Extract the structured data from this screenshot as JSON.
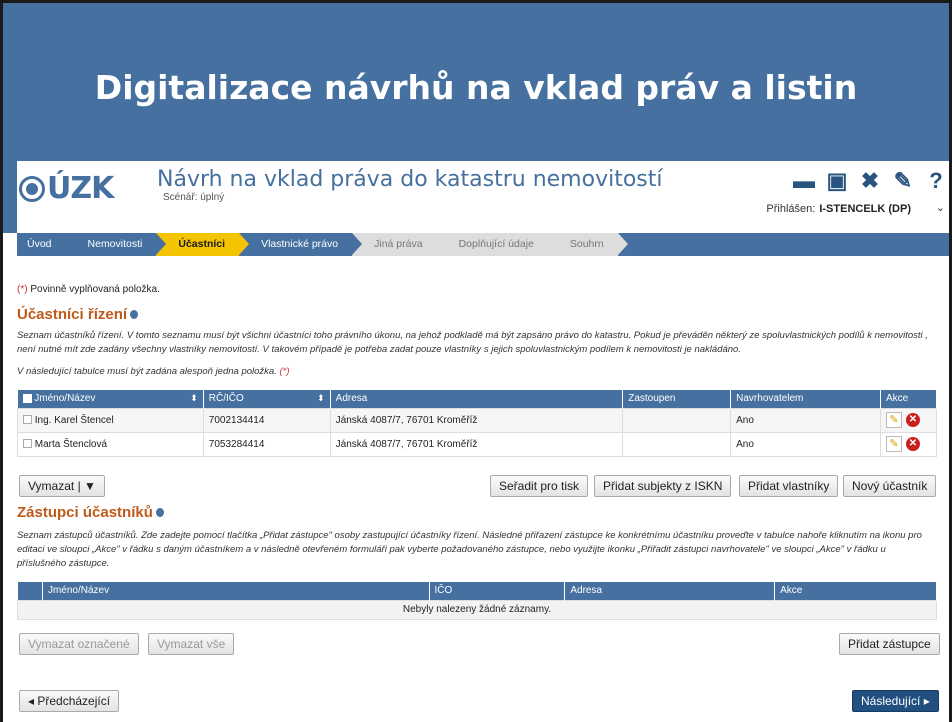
{
  "slide_title": "Digitalizace návrhů na vklad práv a listin",
  "app": {
    "logo": "ÚZK",
    "title": "Návrh na vklad práva do katastru nemovitostí",
    "scenario": "Scénář: úplný",
    "login_label": "Přihlášen:",
    "login_user": "I-STENCELK (DP)"
  },
  "nav": [
    {
      "label": "Úvod"
    },
    {
      "label": "Nemovitosti"
    },
    {
      "label": "Účastníci"
    },
    {
      "label": "Vlastnické právo"
    },
    {
      "label": "Jiná práva"
    },
    {
      "label": "Doplňující údaje"
    },
    {
      "label": "Souhrn"
    }
  ],
  "required_mark": "(*)",
  "required_note": " Povinně vyplňovaná položka.",
  "participants": {
    "heading": "Účastníci řízení",
    "description": "Seznam účastníků řízení. V tomto seznamu musí být všichni účastníci toho právního úkonu, na jehož podkladě má být zapsáno právo do katastru. Pokud je převáděn některý ze spoluvlastnických podílů k nemovitosti , není nutné mít zde zadány všechny vlastníky nemovitostí. V takovém případě je potřeba zadat pouze vlastníky s jejich spoluvlastnickým podílem k nemovitosti je nakládáno.",
    "table_note": "V následující tabulce musí být zadána alespoň jedna položka.",
    "columns": [
      "Jméno/Název",
      "RČ/IČO",
      "Adresa",
      "Zastoupen",
      "Navrhovatelem",
      "Akce"
    ],
    "rows": [
      {
        "name": "Ing. Karel Štencel",
        "id": "7002134414",
        "address": "Jánská 4087/7, 76701 Kroměříž",
        "represented": "",
        "proposer": "Ano"
      },
      {
        "name": "Marta Štenclová",
        "id": "7053284414",
        "address": "Jánská 4087/7, 76701 Kroměříž",
        "represented": "",
        "proposer": "Ano"
      }
    ],
    "buttons": {
      "delete": "Vymazat | ▼",
      "sort_print": "Seřadit pro tisk",
      "add_iskn": "Přidat subjekty z ISKN",
      "add_owners": "Přidat vlastníky",
      "new_participant": "Nový účastník"
    }
  },
  "representatives": {
    "heading": "Zástupci účastníků",
    "description": "Seznam zástupců účastníků. Zde zadejte pomocí tlačítka „Přidat zástupce\" osoby zastupující účastníky řízení. Následné přiřazení zástupce ke konkrétnímu účastníku proveďte v tabulce nahoře kliknutím na ikonu pro editaci ve sloupci „Akce\" v řádku s daným účastníkem a v následně otevřeném formuláři pak vyberte požadovaného zástupce, nebo využijte ikonku „Přiřadit zástupci navrhovatele\" ve sloupci „Akce\" v řádku u příslušného zástupce.",
    "columns": [
      "Jméno/Název",
      "IČO",
      "Adresa",
      "Akce"
    ],
    "empty": "Nebyly nalezeny žádné záznamy.",
    "buttons": {
      "delete_selected": "Vymazat označené",
      "delete_all": "Vymazat vše",
      "add": "Přidat zástupce"
    }
  },
  "footer": {
    "prev": "◂ Předcházející",
    "next": "Následující ▸"
  }
}
